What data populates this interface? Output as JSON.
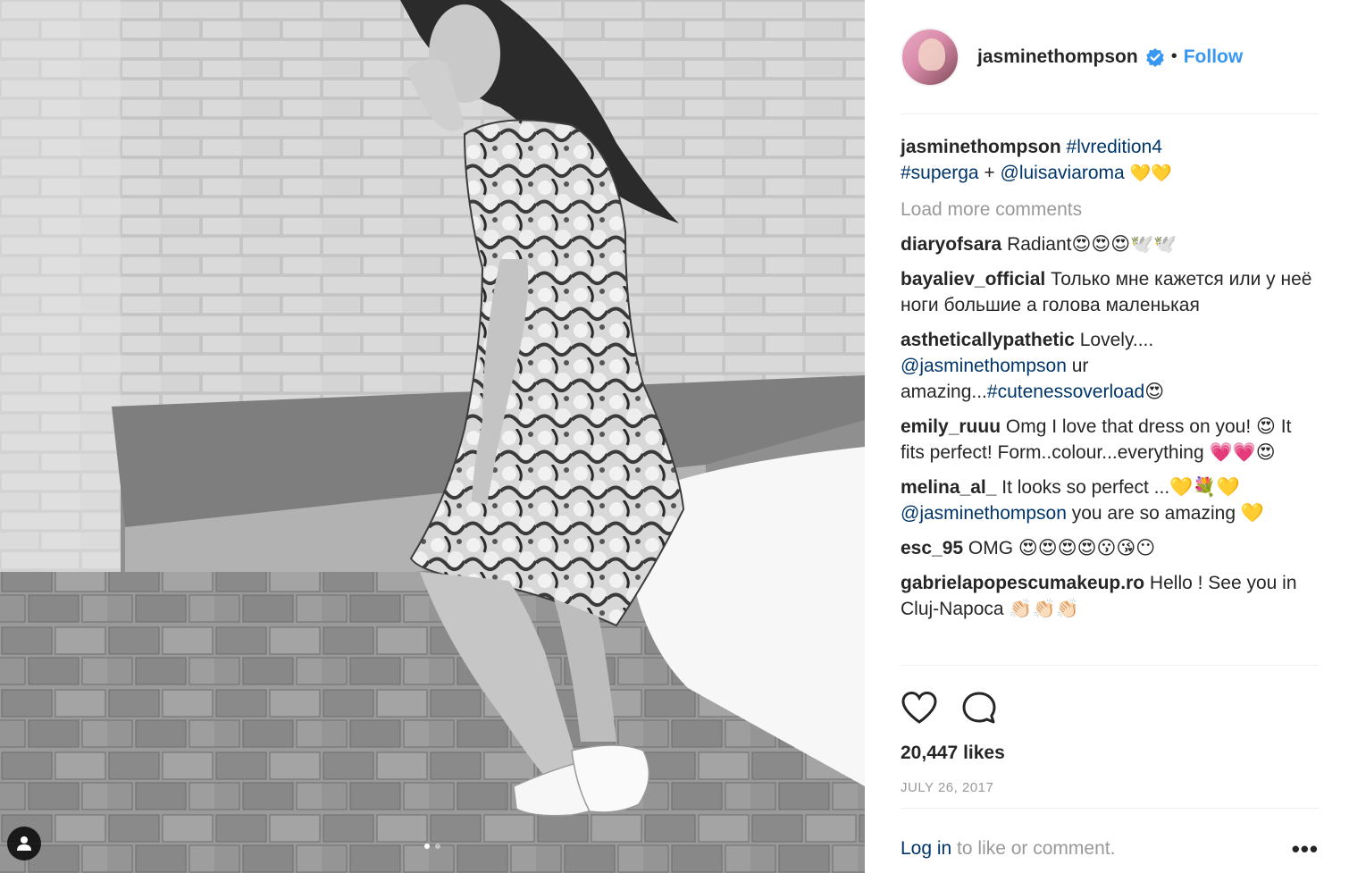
{
  "header": {
    "username": "jasminethompson",
    "separator": "•",
    "follow_label": "Follow"
  },
  "caption": {
    "username": "jasminethompson",
    "hashtag1": "#lvredition4",
    "hashtag2": "#superga",
    "plus": " + ",
    "mention": "@luisaviaroma",
    "emoji": " 💛💛"
  },
  "load_more_label": "Load more comments",
  "comments": [
    {
      "user": "diaryofsara",
      "text": " Radiant😍😍😍🕊️🕊️"
    },
    {
      "user": "bayaliev_official",
      "text": " Только мне кажется или у неё ноги большие а голова маленькая"
    },
    {
      "user": "astheticallypathetic",
      "text1": " Lovely.... ",
      "mention": "@jasminethompson",
      "text2": " ur amazing...",
      "hashtag": "#cutenessoverload",
      "text3": "😍"
    },
    {
      "user": "emily_ruuu",
      "text": " Omg I love that dress on you! 😍 It fits perfect! Form..colour...everything 💗💗😍"
    },
    {
      "user": "melina_al_",
      "text1": " It looks so perfect ...💛💐💛 ",
      "mention": "@jasminethompson",
      "text2": " you are so amazing 💛"
    },
    {
      "user": "esc_95",
      "text": " OMG 😍😍😍😍😗😘😶"
    },
    {
      "user": "gabrielapopescumakeup.ro",
      "text": " Hello ! See you in Cluj-Napoca 👏🏻👏🏻👏🏻"
    }
  ],
  "likes_label": "20,447 likes",
  "date_label": "JULY 26, 2017",
  "footer": {
    "login_label": "Log in",
    "rest_label": " to like or comment.",
    "more_label": "•••"
  },
  "carousel": {
    "count": 2,
    "active": 0
  },
  "icons": {
    "verified": "verified-badge-icon",
    "like": "heart-icon",
    "comment": "comment-bubble-icon",
    "tag": "user-tag-icon",
    "more": "more-options-icon"
  },
  "colors": {
    "link": "#003569",
    "follow": "#3897f0",
    "muted": "#999999",
    "text": "#262626"
  }
}
